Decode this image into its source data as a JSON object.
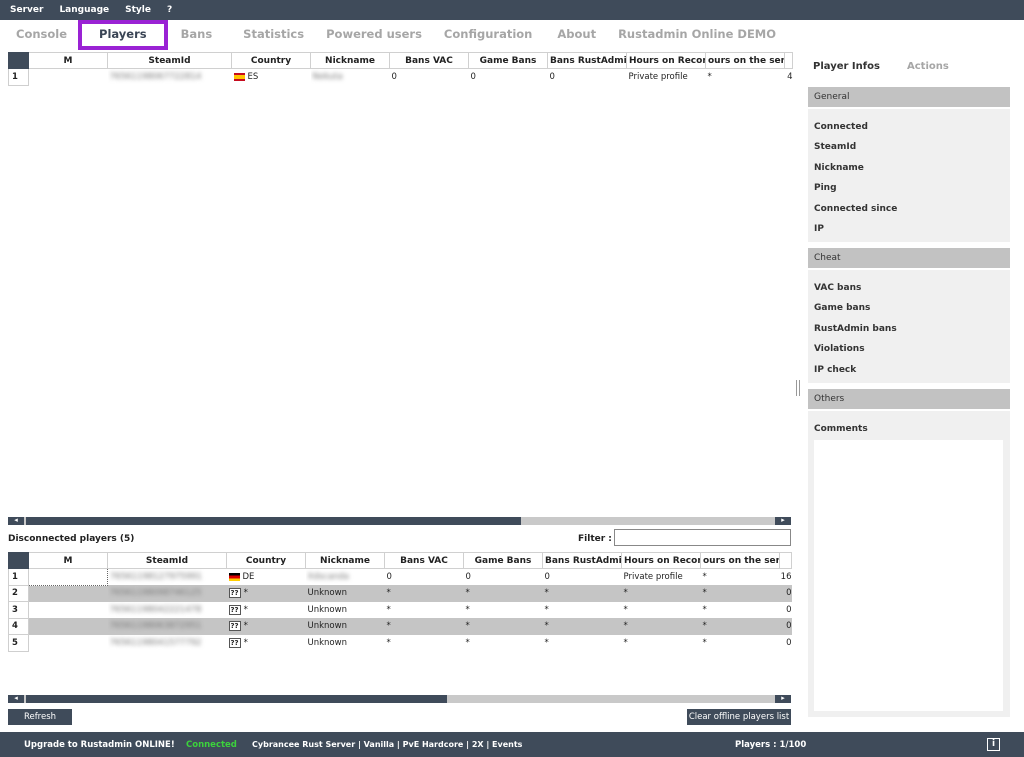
{
  "menu": [
    "Server",
    "Language",
    "Style",
    "?"
  ],
  "tabs": [
    "Console",
    "Players",
    "Bans",
    "Statistics",
    "Powered users",
    "Configuration",
    "About",
    "Rustadmin Online DEMO"
  ],
  "columns": [
    "M",
    "SteamId",
    "Country",
    "Nickname",
    "Bans VAC",
    "Game Bans",
    "Bans RustAdmin",
    "Hours on Record",
    "ours on the serv"
  ],
  "online_players": [
    {
      "row": "1",
      "m": "",
      "steamid": "76561198067722814",
      "country": "ES",
      "flag": "es",
      "nickname": "Nekuta",
      "vac": "0",
      "game": "0",
      "rustadmin": "0",
      "hours": "Private profile",
      "server": "*",
      "extra": "4"
    }
  ],
  "disconnected": {
    "label": "Disconnected players (5)",
    "filter_label": "Filter :",
    "filter_value": "",
    "rows": [
      {
        "row": "1",
        "m": "",
        "steamid": "76561198127975991",
        "country": "DE",
        "flag": "de",
        "nickname": "Xdscanda",
        "vac": "0",
        "game": "0",
        "rustadmin": "0",
        "hours": "Private profile",
        "server": "*",
        "extra": "16"
      },
      {
        "row": "2",
        "m": "",
        "steamid": "76561198098746125",
        "country": "*",
        "flag": "unk",
        "nickname": "Unknown",
        "vac": "*",
        "game": "*",
        "rustadmin": "*",
        "hours": "*",
        "server": "*",
        "extra": "0"
      },
      {
        "row": "3",
        "m": "",
        "steamid": "76561198042221478",
        "country": "*",
        "flag": "unk",
        "nickname": "Unknown",
        "vac": "*",
        "game": "*",
        "rustadmin": "*",
        "hours": "*",
        "server": "*",
        "extra": "0"
      },
      {
        "row": "4",
        "m": "",
        "steamid": "76561198063872951",
        "country": "*",
        "flag": "unk",
        "nickname": "Unknown",
        "vac": "*",
        "game": "*",
        "rustadmin": "*",
        "hours": "*",
        "server": "*",
        "extra": "0"
      },
      {
        "row": "5",
        "m": "",
        "steamid": "76561198041577792",
        "country": "*",
        "flag": "unk",
        "nickname": "Unknown",
        "vac": "*",
        "game": "*",
        "rustadmin": "*",
        "hours": "*",
        "server": "*",
        "extra": "0"
      }
    ]
  },
  "unknown_flag": "??",
  "buttons": {
    "refresh": "Refresh",
    "clear": "Clear offline players list"
  },
  "right": {
    "tab_infos": "Player Infos",
    "tab_actions": "Actions",
    "general": "General",
    "general_items": [
      "Connected",
      "SteamId",
      "Nickname",
      "Ping",
      "Connected since",
      "IP"
    ],
    "cheat": "Cheat",
    "cheat_items": [
      "VAC bans",
      "Game bans",
      "RustAdmin bans",
      "Violations",
      "IP check"
    ],
    "others": "Others",
    "comments": "Comments"
  },
  "status": {
    "upgrade": "Upgrade to Rustadmin ONLINE!",
    "connected": "Connected",
    "server": "Cybrancee Rust Server | Vanilla | PvE Hardcore | 2X | Events",
    "players": "Players : 1/100",
    "info_icon": "i"
  },
  "colors": {
    "dark": "#3f4b5a",
    "accent": "#9a22d4",
    "connected": "#3cd23c"
  }
}
